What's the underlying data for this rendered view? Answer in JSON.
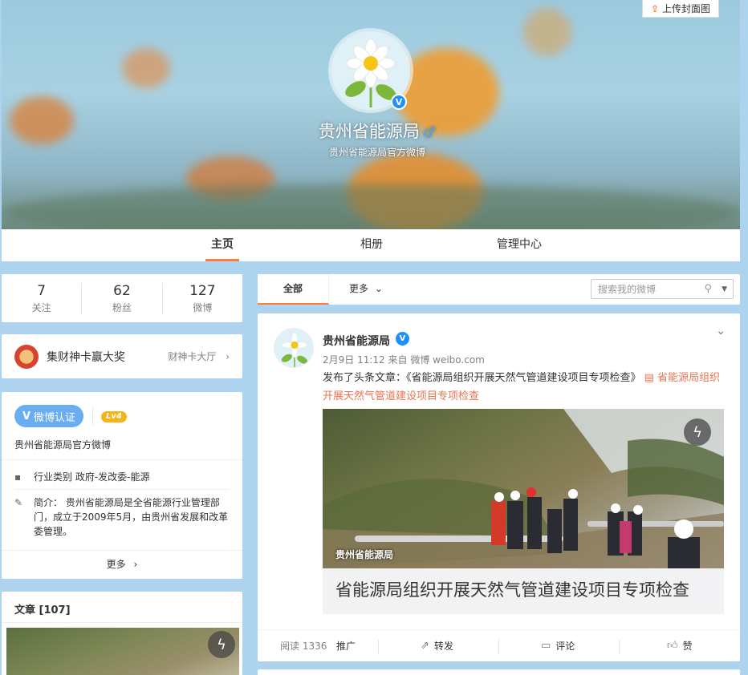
{
  "cover": {
    "upload_label": "上传封面图",
    "profile_name": "贵州省能源局",
    "profile_subtitle": "贵州省能源局官方微博"
  },
  "nav_tabs": [
    {
      "label": "主页",
      "active": true
    },
    {
      "label": "相册",
      "active": false
    },
    {
      "label": "管理中心",
      "active": false
    }
  ],
  "stats": [
    {
      "value": "7",
      "label": "关注"
    },
    {
      "value": "62",
      "label": "粉丝"
    },
    {
      "value": "127",
      "label": "微博"
    }
  ],
  "lucky_card": {
    "title": "集财神卡赢大奖",
    "link_label": "财神卡大厅"
  },
  "verification": {
    "button_label": "微博认证",
    "level_label": "Lv4",
    "description": "贵州省能源局官方微博",
    "industry_label": "行业类别",
    "industry_value": "政府-发改委-能源",
    "intro_label": "简介：",
    "intro_value": "贵州省能源局是全省能源行业管理部门，成立于2009年5月，由贵州省发展和改革委管理。",
    "more_label": "更多"
  },
  "articles": {
    "title": "文章 [107]"
  },
  "feed_tabs": {
    "all_label": "全部",
    "more_label": "更多",
    "search_placeholder": "搜索我的微博"
  },
  "post": {
    "author": "贵州省能源局",
    "time": "2月9日 11:12",
    "source": "来自 微博 weibo.com",
    "text_prefix": "发布了头条文章：《省能源局组织开展天然气管道建设项目专项检查》",
    "link_text": "省能源局组织开展天然气管道建设项目专项检查",
    "image_watermark": "贵州省能源局",
    "card_title": "省能源局组织开展天然气管道建设项目专项检查",
    "reads": "阅读 1336",
    "promote_label": "推广",
    "repost_label": "转发",
    "comment_label": "评论",
    "like_label": "赞"
  },
  "colors": {
    "accent": "#fa7d3c",
    "link": "#eb7350",
    "verified_blue": "#1e90ff",
    "page_bg": "#aed3ef"
  }
}
